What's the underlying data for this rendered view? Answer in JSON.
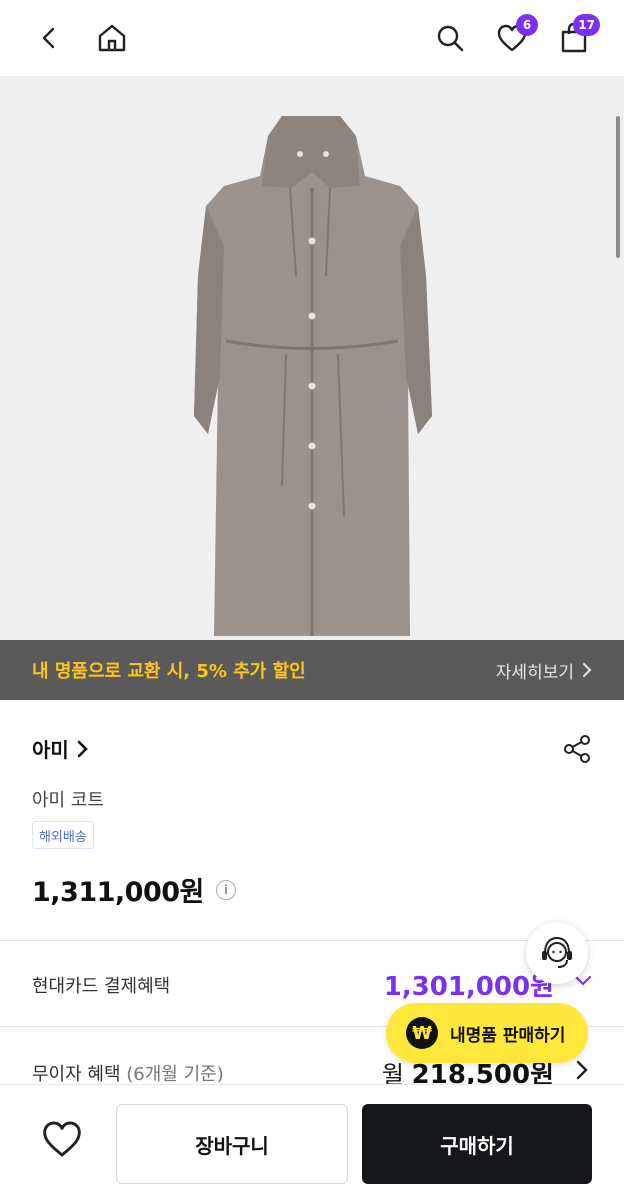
{
  "header": {
    "wishlist_count": "6",
    "cart_count": "17"
  },
  "hero": {
    "promo_text": "내 명품으로 교환 시, 5% 추가 할인",
    "promo_link": "자세히보기"
  },
  "product": {
    "brand": "아미",
    "name": "아미 코트",
    "shipping_tag": "해외배송",
    "price": "1,311,000원"
  },
  "benefits": {
    "card_label": "현대카드 결제혜택",
    "card_price": "1,301,000원",
    "installment_label": "무이자 혜택",
    "installment_sub": "(6개월 기준)",
    "installment_prefix": "월",
    "installment_price": "218,500원"
  },
  "floating": {
    "sell_label": "내명품 판매하기",
    "sell_icon": "₩"
  },
  "bottom": {
    "cart_label": "장바구니",
    "buy_label": "구매하기"
  },
  "colors": {
    "accent": "#7b2ff7",
    "promo": "#ffc61a",
    "sell": "#ffe83b"
  }
}
